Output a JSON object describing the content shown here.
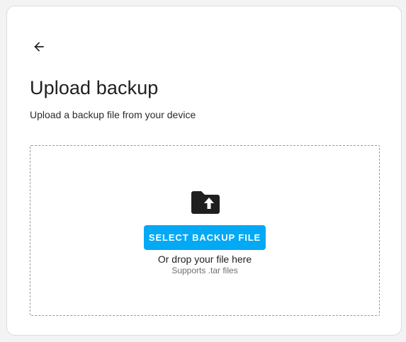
{
  "dialog": {
    "back_icon": "arrow-left-icon",
    "title": "Upload backup",
    "subtitle": "Upload a backup file from your device"
  },
  "dropzone": {
    "icon": "folder-upload-icon",
    "select_button_label": "SELECT BACKUP FILE",
    "drop_text": "Or drop your file here",
    "supports_text": "Supports .tar files"
  },
  "colors": {
    "accent": "#03a9f4",
    "text_primary": "#1f1f1f",
    "text_secondary": "#6f6f6f"
  }
}
